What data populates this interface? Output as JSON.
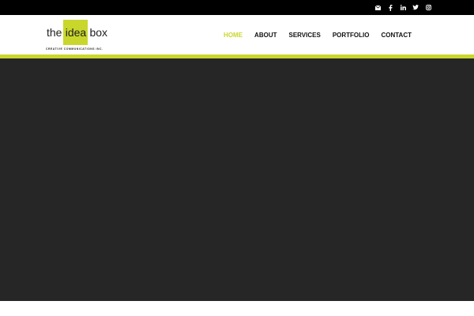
{
  "colors": {
    "accent": "#c9d72c",
    "topbar": "#000000",
    "hero": "#262626",
    "text": "#111111"
  },
  "social": [
    {
      "icon": "envelope-icon"
    },
    {
      "icon": "facebook-icon"
    },
    {
      "icon": "linkedin-icon"
    },
    {
      "icon": "twitter-icon"
    },
    {
      "icon": "instagram-icon"
    }
  ],
  "logo": {
    "word1": "the",
    "word2": "idea",
    "word3": "box",
    "tagline": "CREATIVE COMMUNICATIONS INC."
  },
  "nav": {
    "items": [
      {
        "label": "HOME",
        "active": true
      },
      {
        "label": "ABOUT",
        "active": false
      },
      {
        "label": "SERVICES",
        "active": false
      },
      {
        "label": "PORTFOLIO",
        "active": false
      },
      {
        "label": "CONTACT",
        "active": false
      }
    ]
  }
}
